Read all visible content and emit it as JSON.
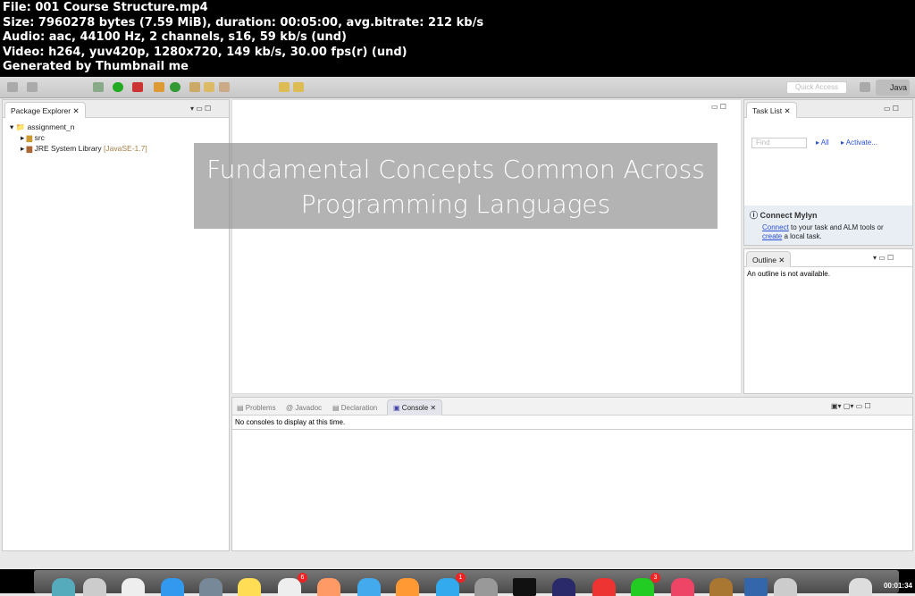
{
  "header": {
    "lines": [
      "File: 001 Course Structure.mp4",
      "Size: 7960278 bytes (7.59 MiB), duration: 00:05:00, avg.bitrate: 212 kb/s",
      "Audio: aac, 44100 Hz, 2 channels, s16, 59 kb/s (und)",
      "Video: h264, yuv420p, 1280x720, 149 kb/s, 30.00 fps(r) (und)",
      "Generated by Thumbnail me"
    ]
  },
  "toolbar": {
    "quick_access": "Quick Access",
    "perspective": "Java"
  },
  "package_explorer": {
    "title": "Package Explorer",
    "project": "assignment_n",
    "items": [
      {
        "label": "src",
        "extra": ""
      },
      {
        "label": "JRE System Library",
        "extra": "[JavaSE-1.7]"
      }
    ]
  },
  "overlay": {
    "line1": "Fundamental Concepts Common Across",
    "line2": "Programming Languages"
  },
  "task_list": {
    "title": "Task List",
    "find_placeholder": "Find",
    "all": "All",
    "activate": "Activate..."
  },
  "mylyn": {
    "title": "Connect Mylyn",
    "connect": "Connect",
    "text1": " to your task and ALM tools or",
    "create": "create",
    "text2": " a local task."
  },
  "outline": {
    "title": "Outline",
    "message": "An outline is not available."
  },
  "bottom": {
    "tabs": [
      "Problems",
      "Javadoc",
      "Declaration",
      "Console"
    ],
    "message": "No consoles to display at this time."
  },
  "dock": {
    "badges": [
      "6",
      "1",
      "3"
    ],
    "timestamp": "00:01:34"
  }
}
